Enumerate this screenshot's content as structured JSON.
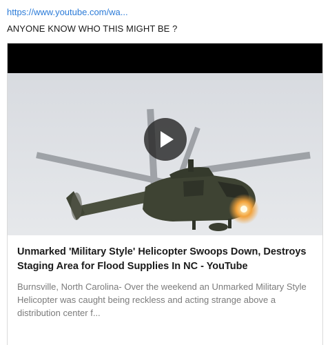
{
  "post": {
    "link_text": "https://www.youtube.com/wa...",
    "body_text": "ANYONE KNOW WHO THIS MIGHT BE ?"
  },
  "link_preview": {
    "title": "Unmarked 'Military Style' Helicopter Swoops Down, Destroys Staging Area for Flood Supplies In NC - YouTube",
    "description": "Burnsville, North Carolina- Over the weekend an Unmarked Military Style Helicopter was caught being reckless and acting strange above a distribution center f...",
    "thumbnail_icon": "play-icon"
  },
  "colors": {
    "link": "#2b7bd8",
    "title": "#1a1a1a",
    "description": "#7b7b7b"
  }
}
